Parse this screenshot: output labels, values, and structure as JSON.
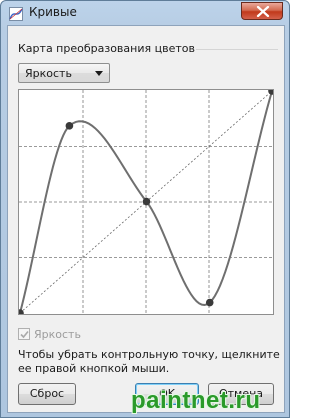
{
  "window": {
    "title": "Кривые",
    "close_icon": "close-icon"
  },
  "group": {
    "title": "Карта преобразования цветов"
  },
  "mode_select": {
    "selected": "Яркость"
  },
  "chart_data": {
    "type": "line",
    "xlim": [
      0,
      255
    ],
    "ylim": [
      0,
      255
    ],
    "grid": "4x4 dashed",
    "series": [
      {
        "values": [
          [
            0,
            0
          ],
          [
            255,
            255
          ]
        ]
      },
      {
        "values": [
          [
            0,
            0
          ],
          [
            50,
            215
          ],
          [
            128,
            128
          ],
          [
            192,
            12
          ],
          [
            255,
            255
          ]
        ]
      }
    ]
  },
  "checkbox": {
    "label": "Яркость",
    "checked": true,
    "enabled": false
  },
  "hint": "Чтобы убрать контрольную точку, щелкните ее правой кнопкой мыши.",
  "buttons": {
    "reset": "Сброс",
    "ok": "OK",
    "cancel": "Отмена"
  },
  "watermark": "paintnet.ru",
  "colors": {
    "curve": "#6f6f6f",
    "control_point": "#3a3a3a",
    "title_bar": "#b7cde4",
    "close_button": "#c1391b",
    "watermark": "#2a9a2a"
  }
}
